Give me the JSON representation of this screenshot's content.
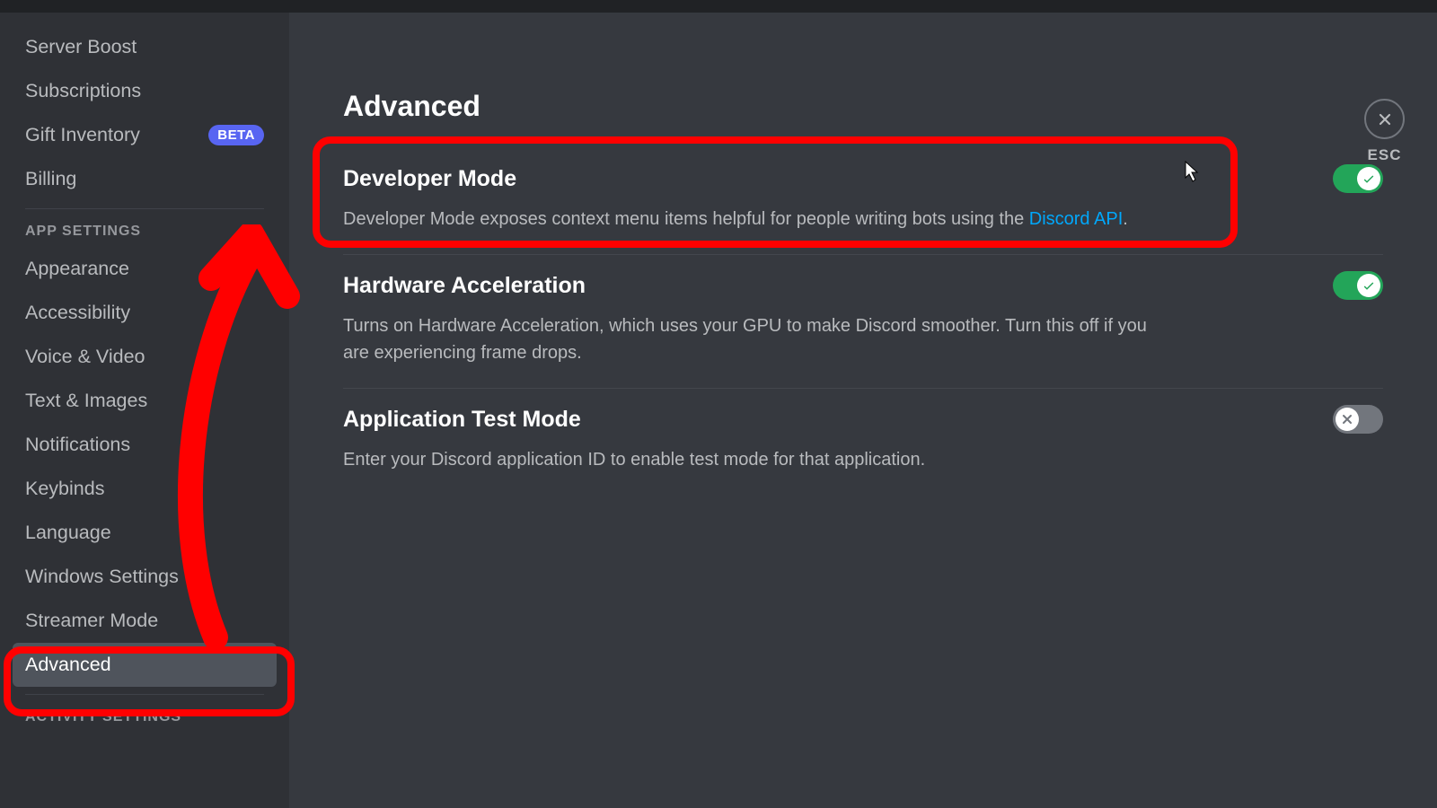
{
  "sidebar": {
    "user_settings_items": [
      {
        "label": "Server Boost",
        "badge": null
      },
      {
        "label": "Subscriptions",
        "badge": null
      },
      {
        "label": "Gift Inventory",
        "badge": "BETA"
      },
      {
        "label": "Billing",
        "badge": null
      }
    ],
    "app_settings_header": "APP SETTINGS",
    "app_settings_items": [
      {
        "label": "Appearance"
      },
      {
        "label": "Accessibility"
      },
      {
        "label": "Voice & Video"
      },
      {
        "label": "Text & Images"
      },
      {
        "label": "Notifications"
      },
      {
        "label": "Keybinds"
      },
      {
        "label": "Language"
      },
      {
        "label": "Windows Settings"
      },
      {
        "label": "Streamer Mode"
      },
      {
        "label": "Advanced",
        "selected": true
      }
    ],
    "activity_settings_header": "ACTIVITY SETTINGS"
  },
  "main": {
    "title": "Advanced",
    "close_label": "ESC",
    "settings": [
      {
        "title": "Developer Mode",
        "desc_pre": "Developer Mode exposes context menu items helpful for people writing bots using the ",
        "link_text": "Discord API",
        "desc_post": ".",
        "toggle": true
      },
      {
        "title": "Hardware Acceleration",
        "desc": "Turns on Hardware Acceleration, which uses your GPU to make Discord smoother. Turn this off if you are experiencing frame drops.",
        "toggle": true
      },
      {
        "title": "Application Test Mode",
        "desc": "Enter your Discord application ID to enable test mode for that application.",
        "toggle": false
      }
    ]
  }
}
